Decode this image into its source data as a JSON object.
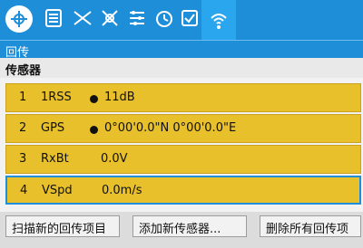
{
  "header": {
    "icons": [
      "home-icon",
      "list-icon",
      "model-icon",
      "failsafe-icon",
      "mixer-icon",
      "timer-icon",
      "checklist-icon",
      "telemetry-icon"
    ]
  },
  "title": "回传",
  "section": "传感器",
  "sensors": [
    {
      "index": "1",
      "name": "1RSS",
      "value": "11dB",
      "dot": true
    },
    {
      "index": "2",
      "name": "GPS",
      "value": "0°00'0.0\"N 0°00'0.0\"E",
      "dot": true
    },
    {
      "index": "3",
      "name": "RxBt",
      "value": "0.0V",
      "dot": false
    },
    {
      "index": "4",
      "name": "VSpd",
      "value": "0.0m/s",
      "dot": false
    }
  ],
  "buttons": {
    "discover": "扫描新的回传项目",
    "add": "添加新传感器...",
    "delete": "删除所有回传项"
  },
  "colors": {
    "accent": "#1e8ed8",
    "row": "#e8c02b",
    "selected": "#1e8ed8"
  }
}
